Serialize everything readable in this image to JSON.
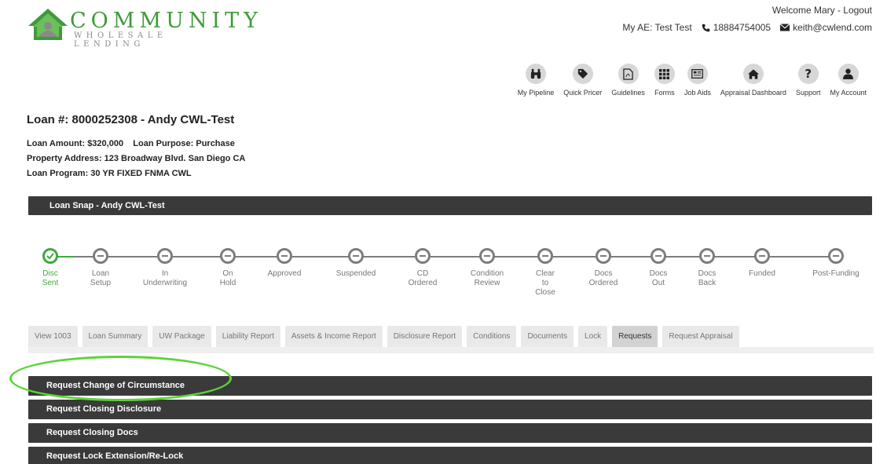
{
  "brand": {
    "name": "COMMUNITY",
    "tagline": "WHOLESALE LENDING",
    "color": "#3f9a3a"
  },
  "header": {
    "welcome": "Welcome Mary - Logout",
    "ae": "My AE: Test Test",
    "phone": "18884754005",
    "email": "keith@cwlend.com"
  },
  "nav": [
    {
      "label": "My Pipeline",
      "icon": "binoculars-icon"
    },
    {
      "label": "Quick Pricer",
      "icon": "tag-icon"
    },
    {
      "label": "Guidelines",
      "icon": "pdf-icon"
    },
    {
      "label": "Forms",
      "icon": "grid-icon"
    },
    {
      "label": "Job Aids",
      "icon": "newspaper-icon"
    },
    {
      "label": "Appraisal Dashboard",
      "icon": "home-icon"
    },
    {
      "label": "Support",
      "icon": "question-icon"
    },
    {
      "label": "My Account",
      "icon": "user-icon"
    }
  ],
  "loan": {
    "title": "Loan #: 8000252308 - Andy CWL-Test",
    "amount_purpose": "Loan Amount: $320,000    Loan Purpose: Purchase",
    "address": "Property Address: 123 Broadway Blvd. San Diego CA",
    "program": "Loan Program: 30 YR FIXED FNMA CWL"
  },
  "snap_bar": "Loan Snap - Andy CWL-Test",
  "timeline": [
    {
      "label": "Disc\nSent",
      "done": true
    },
    {
      "label": "Loan\nSetup",
      "done": false
    },
    {
      "label": "In\nUnderwriting",
      "done": false
    },
    {
      "label": "On\nHold",
      "done": false
    },
    {
      "label": "Approved",
      "done": false
    },
    {
      "label": "Suspended",
      "done": false
    },
    {
      "label": "CD\nOrdered",
      "done": false
    },
    {
      "label": "Condition\nReview",
      "done": false
    },
    {
      "label": "Clear\nto\nClose",
      "done": false
    },
    {
      "label": "Docs\nOrdered",
      "done": false
    },
    {
      "label": "Docs\nOut",
      "done": false
    },
    {
      "label": "Docs\nBack",
      "done": false
    },
    {
      "label": "Funded",
      "done": false
    },
    {
      "label": "Post-Funding",
      "done": false
    }
  ],
  "tabs": [
    {
      "label": "View 1003",
      "active": false
    },
    {
      "label": "Loan Summary",
      "active": false
    },
    {
      "label": "UW Package",
      "active": false
    },
    {
      "label": "Liability Report",
      "active": false
    },
    {
      "label": "Assets & Income Report",
      "active": false
    },
    {
      "label": "Disclosure Report",
      "active": false
    },
    {
      "label": "Conditions",
      "active": false
    },
    {
      "label": "Documents",
      "active": false
    },
    {
      "label": "Lock",
      "active": false
    },
    {
      "label": "Requests",
      "active": true
    },
    {
      "label": "Request Appraisal",
      "active": false
    }
  ],
  "requests": [
    "Request Change of Circumstance",
    "Request Closing Disclosure",
    "Request Closing Docs",
    "Request Lock Extension/Re-Lock"
  ],
  "colors": {
    "accent_green": "#3fa93f",
    "dark_bar": "#3a3a3a",
    "highlight": "#5dd33a"
  }
}
